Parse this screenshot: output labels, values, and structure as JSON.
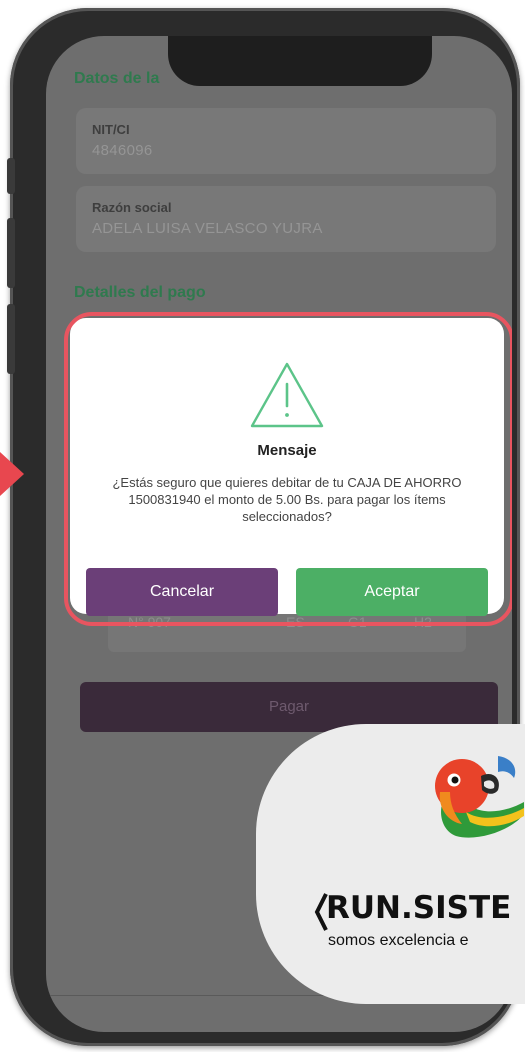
{
  "page": {
    "section_billing": "Datos de la",
    "nit_label": "NIT/CI",
    "nit_value": "4846096",
    "razon_label": "Razón social",
    "razon_value": "ADELA LUISA  VELASCO YUJRA",
    "section_payment": "Detalles del pago",
    "row": {
      "number": "N° 907",
      "c1": "ES",
      "c2": "G1",
      "c3": "H2"
    },
    "pay_button": "Pagar"
  },
  "modal": {
    "icon": "warning-triangle-icon",
    "title": "Mensaje",
    "message": "¿Estás seguro que quieres debitar de tu CAJA DE AHORRO 1500831940 el monto de 5.00 Bs. para pagar los ítems seleccionados?",
    "cancel_label": "Cancelar",
    "accept_label": "Aceptar"
  },
  "brand": {
    "name": "RUN.SISTE",
    "tagline": "somos excelencia e"
  },
  "colors": {
    "section_green": "#2f7a4e",
    "cancel_purple": "#6b3f78",
    "accept_green": "#4caf65",
    "highlight_red": "#e85560"
  }
}
